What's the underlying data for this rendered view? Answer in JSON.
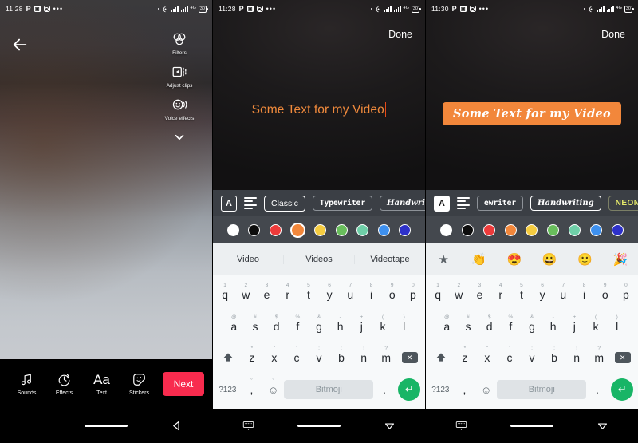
{
  "panels": [
    {
      "id": "editor",
      "statusbar": {
        "time": "11:28",
        "icons": [
          "P",
          "sq-icon",
          "instagram-icon",
          "more-dots-icon"
        ],
        "right_icons": [
          "dot-icon",
          "cast-icon",
          "signal-bars-icon",
          "signal-bars-2-icon",
          "network-speed-icon",
          "battery-icon"
        ],
        "network_label": "4G",
        "battery_label": "30"
      },
      "back_icon": "back-arrow-icon",
      "tools": [
        {
          "label": "Filters",
          "icon": "filters-icon"
        },
        {
          "label": "Adjust clips",
          "icon": "adjust-clips-icon"
        },
        {
          "label": "Voice effects",
          "icon": "voice-effects-icon"
        }
      ],
      "collapse_icon": "chevron-down-icon",
      "bottom_items": [
        {
          "label": "Sounds",
          "icon": "music-note-icon"
        },
        {
          "label": "Effects",
          "icon": "timer-effects-icon"
        },
        {
          "label": "Text",
          "icon": "text-aa-icon"
        },
        {
          "label": "Stickers",
          "icon": "sticker-icon"
        }
      ],
      "next_label": "Next",
      "nav": {
        "home_icon": "home-pill-icon",
        "back_icon": "nav-back-triangle-icon"
      }
    },
    {
      "id": "text-editing",
      "statusbar": {
        "time": "11:28",
        "network_label": "4G",
        "battery_label": "30"
      },
      "done_label": "Done",
      "text_value": "Some Text for my Video",
      "text_plain": "Some Text for my ",
      "text_underlined": "Video",
      "text_color": "#F08A3C",
      "underline_color": "#3E7FD8",
      "caret_color": "#E64A19",
      "toolbar": {
        "bg_button_icon": "text-background-icon",
        "bg_button_label": "A",
        "align_button_icon": "text-align-icon",
        "fonts": [
          {
            "label": "Classic",
            "style": "classic",
            "selected": true
          },
          {
            "label": "Typewriter",
            "style": "typewriter",
            "selected": false
          },
          {
            "label": "Handwriting",
            "style": "handwriting",
            "selected": false
          }
        ]
      },
      "colors": [
        {
          "name": "white",
          "hex": "#FFFFFF",
          "selected": false
        },
        {
          "name": "black",
          "hex": "#0D0D0D",
          "selected": false
        },
        {
          "name": "red",
          "hex": "#EE3B3B",
          "selected": false
        },
        {
          "name": "orange",
          "hex": "#F2873B",
          "selected": true
        },
        {
          "name": "yellow",
          "hex": "#F5CC40",
          "selected": false
        },
        {
          "name": "green",
          "hex": "#69BE5C",
          "selected": false
        },
        {
          "name": "mint",
          "hex": "#6FCFA8",
          "selected": false
        },
        {
          "name": "blue",
          "hex": "#3E90EE",
          "selected": false
        },
        {
          "name": "indigo",
          "hex": "#2E31C9",
          "selected": false
        }
      ],
      "suggestions": [
        "Video",
        "Videos",
        "Videotape"
      ],
      "keyboard": {
        "row1": [
          {
            "key": "q",
            "sup": "1"
          },
          {
            "key": "w",
            "sup": "2"
          },
          {
            "key": "e",
            "sup": "3"
          },
          {
            "key": "r",
            "sup": "4"
          },
          {
            "key": "t",
            "sup": "5"
          },
          {
            "key": "y",
            "sup": "6"
          },
          {
            "key": "u",
            "sup": "7"
          },
          {
            "key": "i",
            "sup": "8"
          },
          {
            "key": "o",
            "sup": "9"
          },
          {
            "key": "p",
            "sup": "0"
          }
        ],
        "row2": [
          {
            "key": "a",
            "sup": "@"
          },
          {
            "key": "s",
            "sup": "#"
          },
          {
            "key": "d",
            "sup": "$"
          },
          {
            "key": "f",
            "sup": "%"
          },
          {
            "key": "g",
            "sup": "&"
          },
          {
            "key": "h",
            "sup": "-"
          },
          {
            "key": "j",
            "sup": "+"
          },
          {
            "key": "k",
            "sup": "("
          },
          {
            "key": "l",
            "sup": ")"
          }
        ],
        "row3": [
          {
            "key": "z",
            "sup": "*"
          },
          {
            "key": "x",
            "sup": "\""
          },
          {
            "key": "c",
            "sup": "'"
          },
          {
            "key": "v",
            "sup": ":"
          },
          {
            "key": "b",
            "sup": ";"
          },
          {
            "key": "n",
            "sup": "!"
          },
          {
            "key": "m",
            "sup": "?"
          }
        ],
        "shift_icon": "shift-icon",
        "backspace_icon": "backspace-icon",
        "sym_label": "?123",
        "comma_label": ",",
        "comma_sup": "°",
        "emoji_icon": "emoji-icon",
        "emoji_sup": "°",
        "space_label": "Bitmoji",
        "period_label": ".",
        "enter_icon": "enter-icon"
      },
      "nav": {
        "kb_hide_icon": "keyboard-hide-icon",
        "home_icon": "home-pill-icon",
        "back_icon": "nav-back-triangle-icon"
      }
    },
    {
      "id": "text-styled",
      "statusbar": {
        "time": "11:30",
        "network_label": "4G",
        "battery_label": "30"
      },
      "done_label": "Done",
      "text_value": "Some Text for my Video",
      "chip_bg": "#F2873B",
      "chip_text_color": "#FFFFFF",
      "toolbar": {
        "bg_button_label": "A",
        "bg_button_active": true,
        "align_button_icon": "text-align-icon",
        "fonts": [
          {
            "label": "ewriter",
            "style": "typewriter",
            "selected": false
          },
          {
            "label": "Handwriting",
            "style": "handwriting",
            "selected": true
          },
          {
            "label": "NEON",
            "style": "neon",
            "selected": false
          }
        ]
      },
      "colors": [
        {
          "name": "white",
          "hex": "#FFFFFF",
          "selected": false
        },
        {
          "name": "black",
          "hex": "#0D0D0D",
          "selected": false
        },
        {
          "name": "red",
          "hex": "#EE3B3B",
          "selected": false
        },
        {
          "name": "orange",
          "hex": "#F2873B",
          "selected": false
        },
        {
          "name": "yellow",
          "hex": "#F5CC40",
          "selected": false
        },
        {
          "name": "green",
          "hex": "#69BE5C",
          "selected": false
        },
        {
          "name": "mint",
          "hex": "#6FCFA8",
          "selected": false
        },
        {
          "name": "blue",
          "hex": "#3E90EE",
          "selected": false
        },
        {
          "name": "indigo",
          "hex": "#2E31C9",
          "selected": false
        }
      ],
      "emoji_suggestions": [
        {
          "name": "star-emoji",
          "glyph": "★"
        },
        {
          "name": "clapping-hands-emoji",
          "glyph": "👏"
        },
        {
          "name": "heart-eyes-emoji",
          "glyph": "😍"
        },
        {
          "name": "grinning-emoji",
          "glyph": "😀"
        },
        {
          "name": "smile-emoji",
          "glyph": "🙂"
        },
        {
          "name": "party-popper-emoji",
          "glyph": "🎉"
        }
      ],
      "keyboard": {
        "row1": [
          {
            "key": "q",
            "sup": "1"
          },
          {
            "key": "w",
            "sup": "2"
          },
          {
            "key": "e",
            "sup": "3"
          },
          {
            "key": "r",
            "sup": "4"
          },
          {
            "key": "t",
            "sup": "5"
          },
          {
            "key": "y",
            "sup": "6"
          },
          {
            "key": "u",
            "sup": "7"
          },
          {
            "key": "i",
            "sup": "8"
          },
          {
            "key": "o",
            "sup": "9"
          },
          {
            "key": "p",
            "sup": "0"
          }
        ],
        "row2": [
          {
            "key": "a",
            "sup": "@"
          },
          {
            "key": "s",
            "sup": "#"
          },
          {
            "key": "d",
            "sup": "$"
          },
          {
            "key": "f",
            "sup": "%"
          },
          {
            "key": "g",
            "sup": "&"
          },
          {
            "key": "h",
            "sup": "-"
          },
          {
            "key": "j",
            "sup": "+"
          },
          {
            "key": "k",
            "sup": "("
          },
          {
            "key": "l",
            "sup": ")"
          }
        ],
        "row3": [
          {
            "key": "z",
            "sup": "*"
          },
          {
            "key": "x",
            "sup": "\""
          },
          {
            "key": "c",
            "sup": "'"
          },
          {
            "key": "v",
            "sup": ":"
          },
          {
            "key": "b",
            "sup": ";"
          },
          {
            "key": "n",
            "sup": "!"
          },
          {
            "key": "m",
            "sup": "?"
          }
        ],
        "shift_icon": "shift-icon",
        "backspace_icon": "backspace-icon",
        "sym_label": "?123",
        "comma_label": ",",
        "emoji_icon": "emoji-icon",
        "space_label": "Bitmoji",
        "period_label": ".",
        "enter_icon": "enter-icon"
      },
      "nav": {
        "kb_hide_icon": "keyboard-hide-icon",
        "home_icon": "home-pill-icon",
        "back_icon": "nav-back-triangle-icon"
      }
    }
  ]
}
